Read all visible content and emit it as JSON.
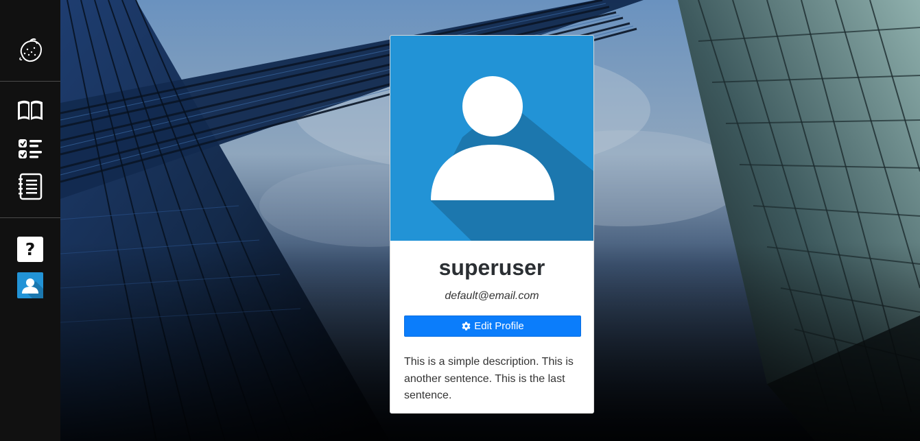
{
  "sidebar": {
    "items": [
      {
        "icon": "lemon-logo-icon"
      },
      {
        "icon": "book-icon"
      },
      {
        "icon": "checklist-icon"
      },
      {
        "icon": "notebook-list-icon"
      },
      {
        "icon": "help-icon",
        "glyph": "?"
      },
      {
        "icon": "profile-avatar-icon"
      }
    ]
  },
  "profile": {
    "username": "superuser",
    "email": "default@email.com",
    "edit_label": "Edit Profile",
    "edit_icon": "gear-icon",
    "description": "This is a simple description. This is another sentence. This is the last sentence.",
    "avatar_bg_color": "#2293d6"
  },
  "colors": {
    "sidebar_bg": "#111111",
    "primary_button": "#0b7dfb"
  }
}
